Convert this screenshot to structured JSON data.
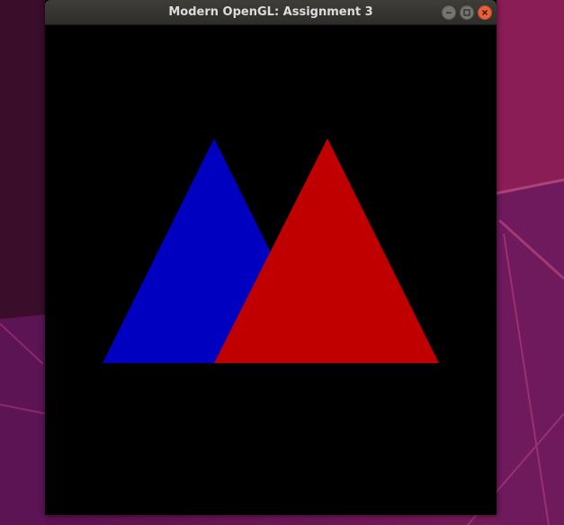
{
  "window": {
    "title": "Modern OpenGL: Assignment 3"
  },
  "controls": {
    "minimize_icon": "minimize-icon",
    "maximize_icon": "maximize-icon",
    "close_icon": "close-icon"
  },
  "colors": {
    "clear": "#000000",
    "triangle_left": "#0000c0",
    "triangle_right": "#c00000",
    "close_button": "#e9613a"
  }
}
